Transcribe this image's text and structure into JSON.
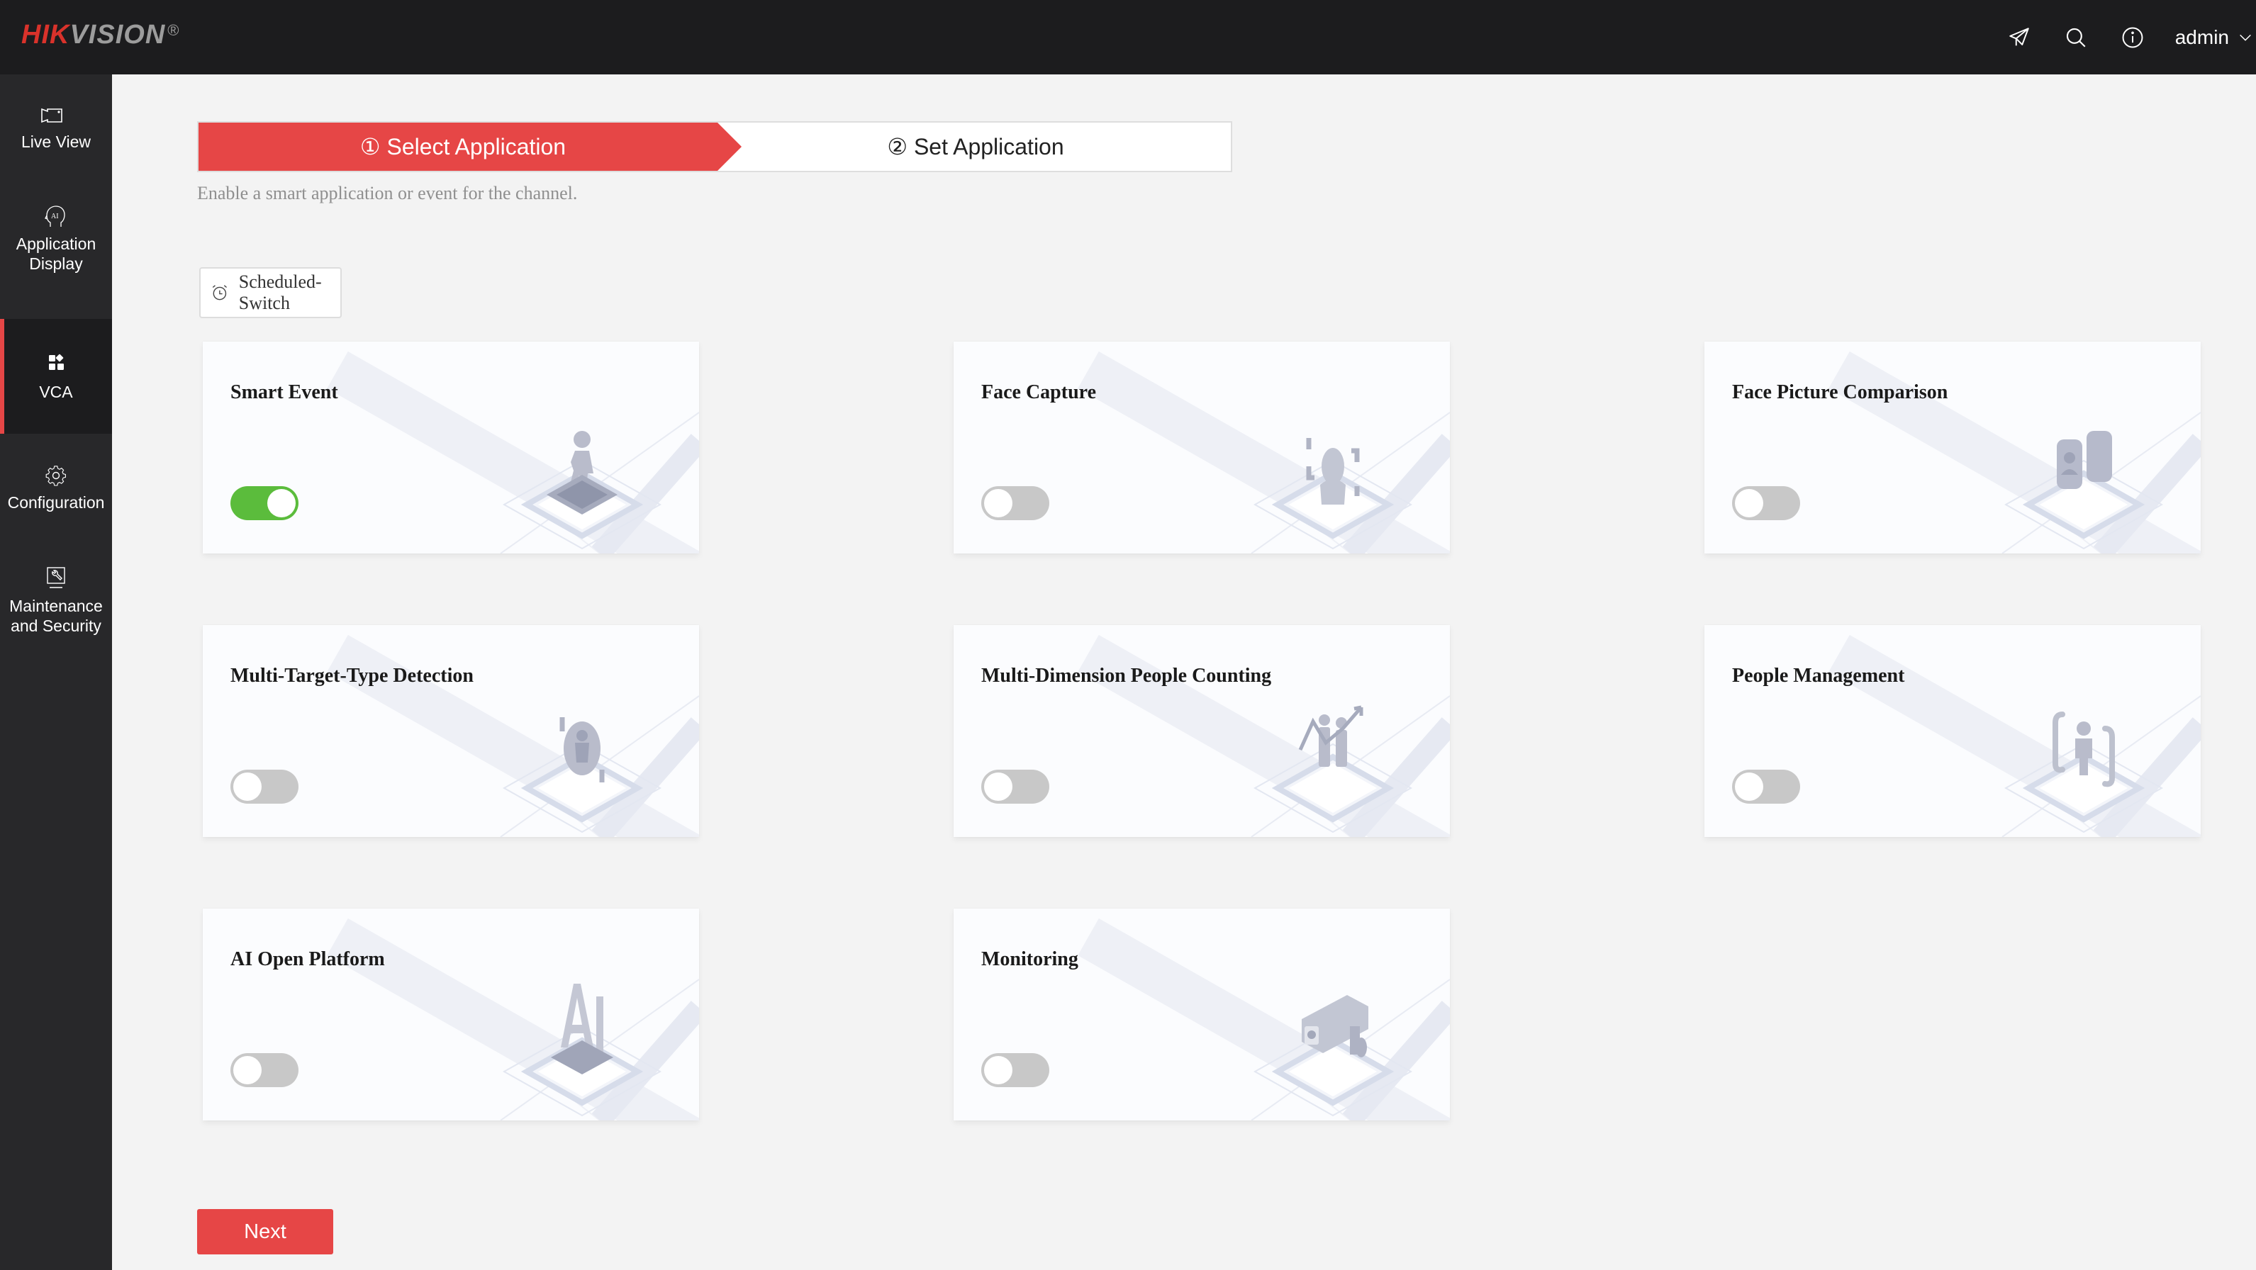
{
  "header": {
    "logo_primary": "HIK",
    "logo_secondary": "VISION",
    "logo_mark": "®",
    "icons": [
      "send-icon",
      "search-icon",
      "info-icon"
    ],
    "user": "admin"
  },
  "sidebar": {
    "items": [
      {
        "label": "Live View",
        "icon": "camera-icon",
        "active": false
      },
      {
        "label": "Application Display",
        "icon": "ai-head-icon",
        "active": false
      },
      {
        "label": "VCA",
        "icon": "vca-grid-icon",
        "active": true
      },
      {
        "label": "Configuration",
        "icon": "gear-icon",
        "active": false
      },
      {
        "label": "Maintenance and Security",
        "icon": "maintenance-icon",
        "active": false
      }
    ]
  },
  "wizard": {
    "steps": [
      {
        "label": "① Select Application",
        "active": true
      },
      {
        "label": "② Set Application",
        "active": false
      }
    ],
    "subtitle": "Enable a smart application or event for the channel."
  },
  "scheduled_switch": {
    "label": "Scheduled-Switch",
    "icon": "alarm-clock-icon"
  },
  "applications": [
    {
      "title": "Smart Event",
      "enabled": true,
      "art": "walking-person"
    },
    {
      "title": "Face Capture",
      "enabled": false,
      "art": "face-frame"
    },
    {
      "title": "Face Picture Comparison",
      "enabled": false,
      "art": "face-compare"
    },
    {
      "title": "Multi-Target-Type Detection",
      "enabled": false,
      "art": "multi-target"
    },
    {
      "title": "Multi-Dimension People Counting",
      "enabled": false,
      "art": "people-counting"
    },
    {
      "title": "People Management",
      "enabled": false,
      "art": "people-management"
    },
    {
      "title": "AI Open Platform",
      "enabled": false,
      "art": "ai-letters"
    },
    {
      "title": "Monitoring",
      "enabled": false,
      "art": "camera"
    }
  ],
  "footer": {
    "next_label": "Next"
  },
  "colors": {
    "accent_red": "#e64646",
    "toggle_on": "#5bbc3c",
    "toggle_off": "#c8c8c8",
    "header_bg": "#1c1c1e",
    "sidebar_bg": "#28282a"
  }
}
